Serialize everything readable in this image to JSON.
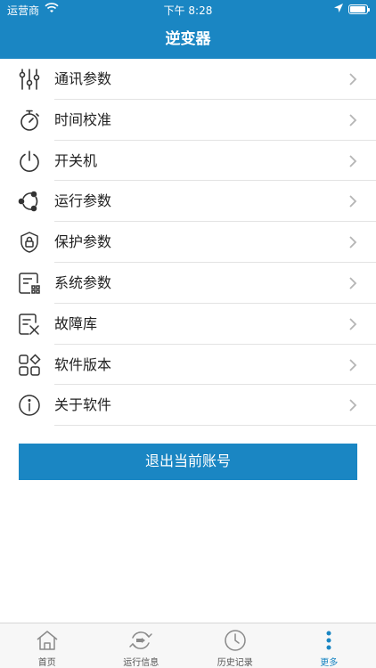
{
  "status_bar": {
    "carrier": "运营商",
    "time": "下午 8:28"
  },
  "nav": {
    "title": "逆变器"
  },
  "menu": [
    {
      "label": "通讯参数",
      "icon": "sliders-icon"
    },
    {
      "label": "时间校准",
      "icon": "stopwatch-icon"
    },
    {
      "label": "开关机",
      "icon": "power-icon"
    },
    {
      "label": "运行参数",
      "icon": "share-nodes-icon"
    },
    {
      "label": "保护参数",
      "icon": "shield-lock-icon"
    },
    {
      "label": "系统参数",
      "icon": "system-settings-icon"
    },
    {
      "label": "故障库",
      "icon": "fault-tools-icon"
    },
    {
      "label": "软件版本",
      "icon": "apps-grid-icon"
    },
    {
      "label": "关于软件",
      "icon": "info-icon"
    }
  ],
  "logout": {
    "label": "退出当前账号"
  },
  "tabs": [
    {
      "label": "首页",
      "icon": "home-icon"
    },
    {
      "label": "运行信息",
      "icon": "run-cycle-icon"
    },
    {
      "label": "历史记录",
      "icon": "clock-icon"
    },
    {
      "label": "更多",
      "icon": "more-dots-icon",
      "active": true
    }
  ],
  "colors": {
    "primary": "#1a86c3",
    "text": "#222222",
    "divider": "#e3e3e3"
  }
}
